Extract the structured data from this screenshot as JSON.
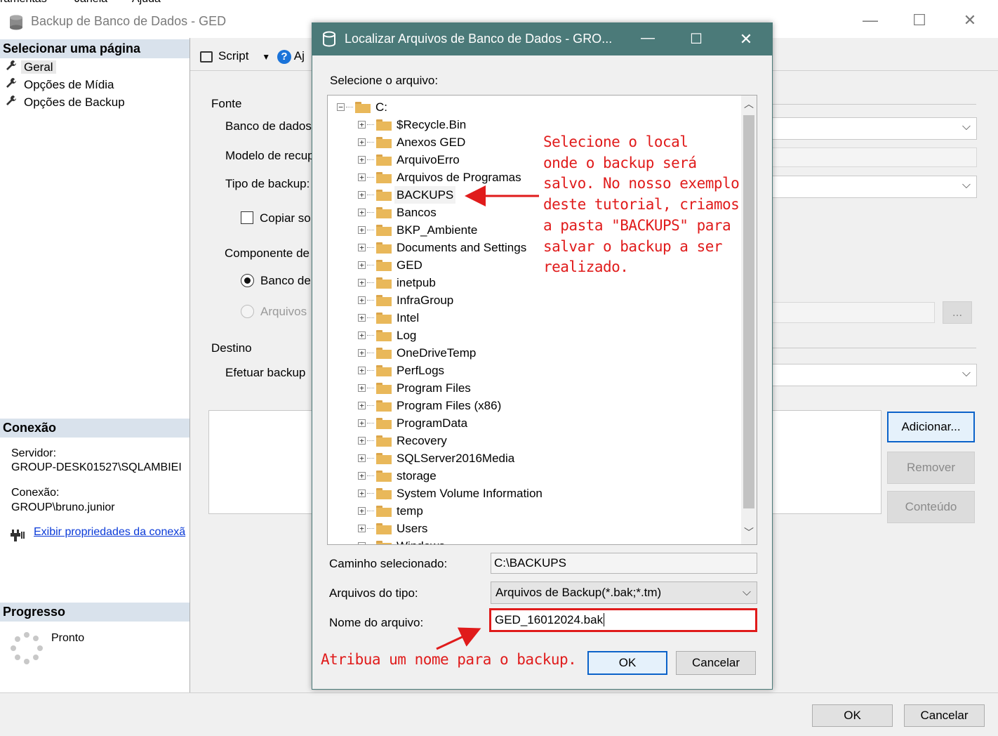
{
  "menu_strip": [
    "ramentas",
    "Janela",
    "Ajuda"
  ],
  "window": {
    "title": "Backup de Banco de Dados - GED",
    "minimize": "—",
    "maximize": "☐",
    "close": "✕"
  },
  "left_pane": {
    "select_page_header": "Selecionar uma página",
    "pages": [
      {
        "label": "Geral"
      },
      {
        "label": "Opções de Mídia"
      },
      {
        "label": "Opções de Backup"
      }
    ],
    "connection_header": "Conexão",
    "server_label": "Servidor:",
    "server_value": "GROUP-DESK01527\\SQLAMBIEI",
    "connection_label": "Conexão:",
    "connection_value": "GROUP\\bruno.junior",
    "view_props_link": "Exibir propriedades da conexã",
    "progress_header": "Progresso",
    "progress_status": "Pronto"
  },
  "toolbar": {
    "script_label": "Script",
    "help_label": "Aj"
  },
  "main": {
    "source_label": "Fonte",
    "database_label": "Banco de dados",
    "recovery_model_label": "Modelo de recup",
    "backup_type_label": "Tipo de backup:",
    "copy_only_label": "Copiar so",
    "component_label": "Componente de",
    "radio_database_label": "Banco de",
    "radio_files_label": "Arquivos",
    "browse_label": "...",
    "destination_label": "Destino",
    "backup_to_label": "Efetuar backup",
    "add_button": "Adicionar...",
    "remove_button": "Remover",
    "contents_button": "Conteúdo"
  },
  "footer": {
    "ok_button": "OK",
    "cancel_button": "Cancelar"
  },
  "dialog": {
    "title": "Localizar Arquivos de Banco de Dados - GRO...",
    "select_file_label": "Selecione o arquivo:",
    "root": "C:",
    "folders": [
      "$Recycle.Bin",
      "Anexos GED",
      "ArquivoErro",
      "Arquivos de Programas",
      "BACKUPS",
      "Bancos",
      "BKP_Ambiente",
      "Documents and Settings",
      "GED",
      "inetpub",
      "InfraGroup",
      "Intel",
      "Log",
      "OneDriveTemp",
      "PerfLogs",
      "Program Files",
      "Program Files (x86)",
      "ProgramData",
      "Recovery",
      "SQLServer2016Media",
      "storage",
      "System Volume Information",
      "temp",
      "Users",
      "Windows"
    ],
    "selected_path_label": "Caminho selecionado:",
    "selected_path_value": "C:\\BACKUPS",
    "file_type_label": "Arquivos do tipo:",
    "file_type_value": "Arquivos de Backup(*.bak;*.tm)",
    "file_name_label": "Nome do arquivo:",
    "file_name_value": "GED_16012024.bak",
    "ok_button": "OK",
    "cancel_button": "Cancelar"
  },
  "annotations": {
    "folder_note": [
      "Selecione o local",
      "onde o backup será",
      "salvo. No nosso exemplo",
      "deste tutorial, criamos",
      "a pasta \"BACKUPS\" para",
      "salvar o backup a ser",
      "realizado."
    ],
    "filename_note": "Atribua um nome para o backup."
  },
  "colors": {
    "dialog_title_bg": "#4b7a79",
    "section_header_bg": "#d9e2ec",
    "annotation_red": "#e01b1b",
    "highlight_box": "#e01b1b",
    "link_blue": "#0a3ad8"
  }
}
